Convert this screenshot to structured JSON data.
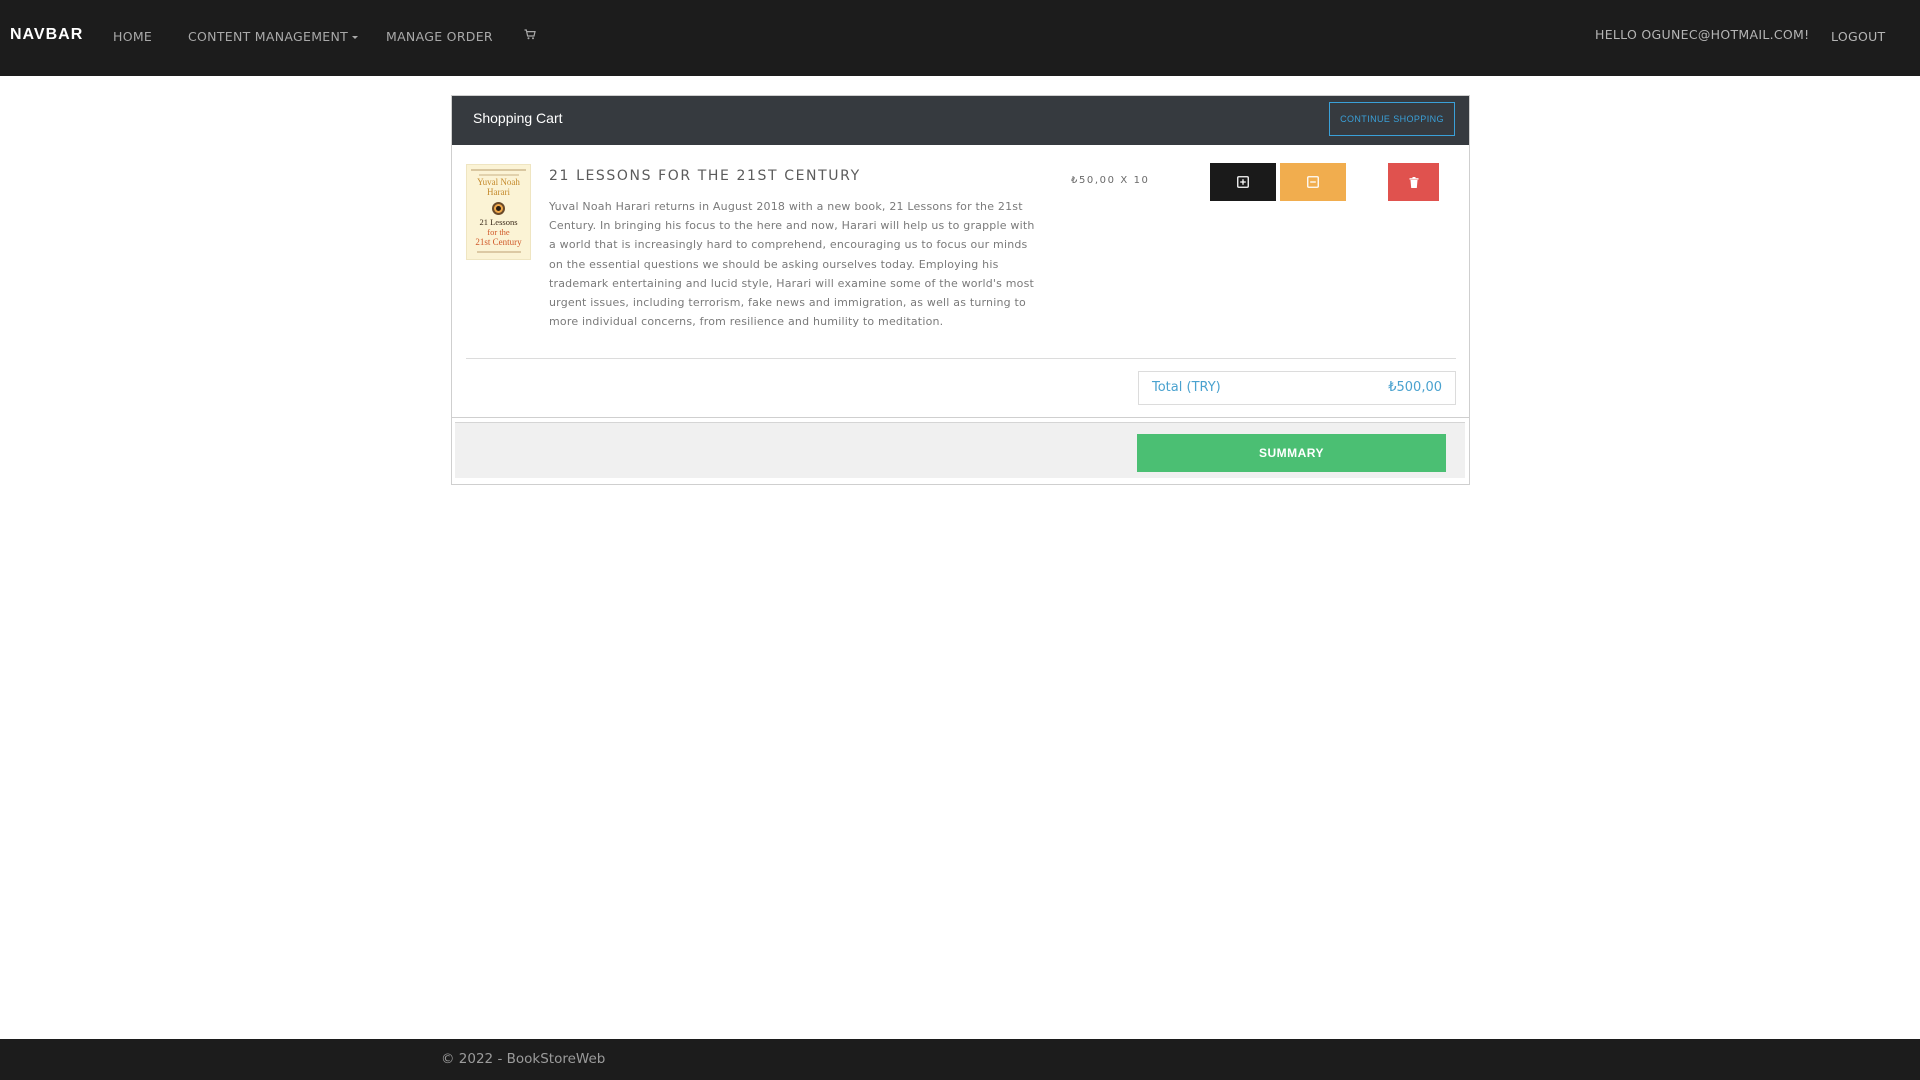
{
  "navbar": {
    "brand": "NAVBAR",
    "links": {
      "home": "HOME",
      "content_management": "CONTENT MANAGEMENT",
      "manage_order": "MANAGE ORDER"
    },
    "cart_icon": "cart-icon",
    "greeting": "HELLO OGUNEC@HOTMAIL.COM!",
    "logout": "LOGOUT"
  },
  "cart": {
    "title": "Shopping Cart",
    "continue_label": "CONTINUE SHOPPING",
    "items": [
      {
        "cover": {
          "author": "Yuval Noah Harari",
          "title_line1": "21 Lessons",
          "title_line2": "for the",
          "title_line3": "21st Century"
        },
        "title": "21 LESSONS FOR THE 21ST CENTURY",
        "description": "Yuval Noah Harari returns in August 2018 with a new book, 21 Lessons for the 21st Century. In bringing his focus to the here and now, Harari will help us to grapple with a world that is increasingly hard to comprehend, encouraging us to focus our minds on the essential questions we should be asking ourselves today. Employing his trademark entertaining and lucid style, Harari will examine some of the world's most urgent issues, including terrorism, fake news and immigration, as well as turning to more individual concerns, from resilience and humility to meditation.",
        "price_qty": "₺50,00 X 10",
        "actions": {
          "increase_icon": "plus-square-icon",
          "decrease_icon": "minus-square-icon",
          "delete_icon": "trash-icon"
        }
      }
    ],
    "total": {
      "label": "Total (TRY)",
      "value": "₺500,00"
    },
    "summary_label": "SUMMARY"
  },
  "footer": {
    "copyright": "© 2022 - BookStoreWeb"
  },
  "colors": {
    "navbar_bg": "#1c1c1c",
    "card_header_bg": "#363a3f",
    "accent_blue": "#3aa0d8",
    "btn_dark": "#1a1a1a",
    "btn_warning": "#f1ad4e",
    "btn_danger": "#e0524e",
    "btn_success": "#4bbf73"
  }
}
